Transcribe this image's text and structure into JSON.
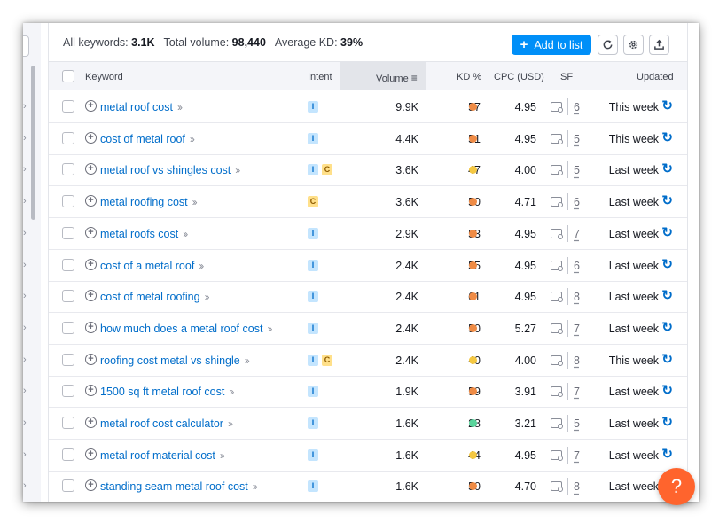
{
  "toolbar": {
    "all_keywords_label": "All keywords:",
    "all_keywords_value": "3.1K",
    "total_volume_label": "Total volume:",
    "total_volume_value": "98,440",
    "avg_kd_label": "Average KD:",
    "avg_kd_value": "39%",
    "add_to_list_label": "Add to list",
    "icons": [
      "plus-icon",
      "refresh-icon",
      "settings-icon",
      "export-icon"
    ]
  },
  "table": {
    "columns": {
      "keyword": "Keyword",
      "intent": "Intent",
      "volume": "Volume",
      "kd": "KD %",
      "cpc": "CPC (USD)",
      "sf": "SF",
      "updated": "Updated"
    },
    "sorted_by": "Volume",
    "rows": [
      {
        "keyword": "metal roof cost",
        "intent": [
          "I"
        ],
        "volume": "9.9K",
        "kd": "57",
        "kd_color": "#ef8b45",
        "cpc": "4.95",
        "sf": "6",
        "updated": "This week"
      },
      {
        "keyword": "cost of metal roof",
        "intent": [
          "I"
        ],
        "volume": "4.4K",
        "kd": "51",
        "kd_color": "#ef8b45",
        "cpc": "4.95",
        "sf": "5",
        "updated": "This week"
      },
      {
        "keyword": "metal roof vs shingles cost",
        "intent": [
          "I",
          "C"
        ],
        "volume": "3.6K",
        "kd": "47",
        "kd_color": "#f5c842",
        "cpc": "4.00",
        "sf": "5",
        "updated": "Last week"
      },
      {
        "keyword": "metal roofing cost",
        "intent": [
          "C"
        ],
        "volume": "3.6K",
        "kd": "50",
        "kd_color": "#ef8b45",
        "cpc": "4.71",
        "sf": "6",
        "updated": "Last week"
      },
      {
        "keyword": "metal roofs cost",
        "intent": [
          "I"
        ],
        "volume": "2.9K",
        "kd": "53",
        "kd_color": "#ef8b45",
        "cpc": "4.95",
        "sf": "7",
        "updated": "Last week"
      },
      {
        "keyword": "cost of a metal roof",
        "intent": [
          "I"
        ],
        "volume": "2.4K",
        "kd": "55",
        "kd_color": "#ef8b45",
        "cpc": "4.95",
        "sf": "6",
        "updated": "Last week"
      },
      {
        "keyword": "cost of metal roofing",
        "intent": [
          "I"
        ],
        "volume": "2.4K",
        "kd": "61",
        "kd_color": "#ef8b45",
        "cpc": "4.95",
        "sf": "8",
        "updated": "Last week"
      },
      {
        "keyword": "how much does a metal roof cost",
        "intent": [
          "I"
        ],
        "volume": "2.4K",
        "kd": "50",
        "kd_color": "#ef8b45",
        "cpc": "5.27",
        "sf": "7",
        "updated": "Last week"
      },
      {
        "keyword": "roofing cost metal vs shingle",
        "intent": [
          "I",
          "C"
        ],
        "volume": "2.4K",
        "kd": "40",
        "kd_color": "#f5c842",
        "cpc": "4.00",
        "sf": "8",
        "updated": "This week"
      },
      {
        "keyword": "1500 sq ft metal roof cost",
        "intent": [
          "I"
        ],
        "volume": "1.9K",
        "kd": "59",
        "kd_color": "#ef8b45",
        "cpc": "3.91",
        "sf": "7",
        "updated": "Last week"
      },
      {
        "keyword": "metal roof cost calculator",
        "intent": [
          "I"
        ],
        "volume": "1.6K",
        "kd": "28",
        "kd_color": "#59d49b",
        "cpc": "3.21",
        "sf": "5",
        "updated": "Last week"
      },
      {
        "keyword": "metal roof material cost",
        "intent": [
          "I"
        ],
        "volume": "1.6K",
        "kd": "44",
        "kd_color": "#f5c842",
        "cpc": "4.95",
        "sf": "7",
        "updated": "Last week"
      },
      {
        "keyword": "standing seam metal roof cost",
        "intent": [
          "I"
        ],
        "volume": "1.6K",
        "kd": "50",
        "kd_color": "#ef8b45",
        "cpc": "4.70",
        "sf": "8",
        "updated": "Last week"
      }
    ]
  },
  "help": {
    "label": "?"
  }
}
